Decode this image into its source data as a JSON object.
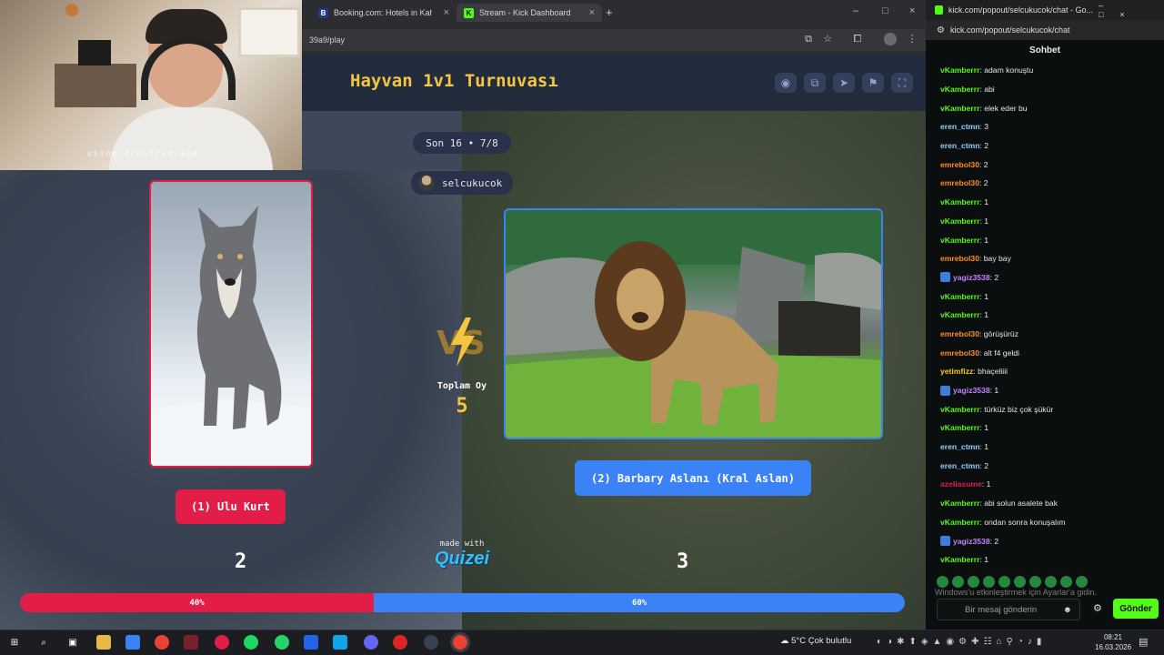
{
  "webcam": {
    "caption": "using droidcam app"
  },
  "browser": {
    "tabs": [
      {
        "label": "Booking.com: Hotels in Kahire.",
        "favicon": "B",
        "color": "#1e3a8a"
      },
      {
        "label": "Stream - Kick Dashboard",
        "favicon": "K",
        "color": "#53fc18"
      }
    ],
    "url": "39a9/play"
  },
  "game": {
    "title": "Hayvan 1v1 Turnuvası",
    "round": "Son 16 • 7/8",
    "user": "selcukucok",
    "left": {
      "label": "(1) Ulu Kurt",
      "votes": "2",
      "percent": "40%",
      "share": 0.4
    },
    "right": {
      "label": "(2) Barbary Aslanı (Kral Aslan)",
      "votes": "3",
      "percent": "60%",
      "share": 0.6
    },
    "vs": "VS",
    "total_label": "Toplam Oy",
    "total_value": "5",
    "made_with": "made with",
    "brand": "Quizei"
  },
  "chat": {
    "window_title": "kick.com/popout/selcukucok/chat - Go...",
    "url": "kick.com/popout/selcukucok/chat",
    "header": "Sohbet",
    "messages": [
      {
        "user": "vKamberrr",
        "text": ": adam konuştu",
        "color": "#53fc18",
        "badge": false
      },
      {
        "user": "vKamberrr",
        "text": ": abi",
        "color": "#53fc18",
        "badge": false
      },
      {
        "user": "vKamberrr",
        "text": ": elek eder bu",
        "color": "#53fc18",
        "badge": false
      },
      {
        "user": "eren_ctmn",
        "text": ": 3",
        "color": "#8fd1ff",
        "badge": false
      },
      {
        "user": "eren_ctmn",
        "text": ": 2",
        "color": "#8fd1ff",
        "badge": false
      },
      {
        "user": "emrebol30",
        "text": ": 2",
        "color": "#ff8f1f",
        "badge": false
      },
      {
        "user": "emrebol30",
        "text": ": 2",
        "color": "#ff8f1f",
        "badge": false
      },
      {
        "user": "vKamberrr",
        "text": ": 1",
        "color": "#53fc18",
        "badge": false
      },
      {
        "user": "vKamberrr",
        "text": ": 1",
        "color": "#53fc18",
        "badge": false
      },
      {
        "user": "vKamberrr",
        "text": ": 1",
        "color": "#53fc18",
        "badge": false
      },
      {
        "user": "emrebol30",
        "text": ": bay bay",
        "color": "#ff8f1f",
        "badge": false
      },
      {
        "user": "yagiz3538",
        "text": ": 2",
        "color": "#c084fc",
        "badge": true
      },
      {
        "user": "vKamberrr",
        "text": ": 1",
        "color": "#53fc18",
        "badge": false
      },
      {
        "user": "vKamberrr",
        "text": ": 1",
        "color": "#53fc18",
        "badge": false
      },
      {
        "user": "emrebol30",
        "text": ": görüşürüz",
        "color": "#ff8f1f",
        "badge": false
      },
      {
        "user": "emrebol30",
        "text": ": alt f4 geldi",
        "color": "#ff8f1f",
        "badge": false
      },
      {
        "user": "yetimfizz",
        "text": ": bhaçeliiii",
        "color": "#facc15",
        "badge": false
      },
      {
        "user": "yagiz3538",
        "text": ": 1",
        "color": "#c084fc",
        "badge": true
      },
      {
        "user": "vKamberrr",
        "text": ": türküz biz çok şükür",
        "color": "#53fc18",
        "badge": false
      },
      {
        "user": "vKamberrr",
        "text": ": 1",
        "color": "#53fc18",
        "badge": false
      },
      {
        "user": "eren_ctmn",
        "text": ": 1",
        "color": "#8fd1ff",
        "badge": false
      },
      {
        "user": "eren_ctmn",
        "text": ": 2",
        "color": "#8fd1ff",
        "badge": false
      },
      {
        "user": "azeliasume",
        "text": ": 1",
        "color": "#e11d48",
        "badge": false
      },
      {
        "user": "vKamberrr",
        "text": ": abi solun asalete bak",
        "color": "#53fc18",
        "badge": false
      },
      {
        "user": "vKamberrr",
        "text": ": ondan sonra konuşalım",
        "color": "#53fc18",
        "badge": false
      },
      {
        "user": "yagiz3538",
        "text": ": 2",
        "color": "#c084fc",
        "badge": true
      },
      {
        "user": "vKamberrr",
        "text": ": 1",
        "color": "#53fc18",
        "badge": false
      }
    ],
    "windows_activation": "Windows'u etkinleştirmek için Ayarlar'a gidin.",
    "input_placeholder": "Bir mesaj gönderin",
    "send_label": "Gönder"
  },
  "taskbar": {
    "weather": "5°C  Çok bulutlu",
    "time": "08:21",
    "date": "16.03.2026"
  }
}
